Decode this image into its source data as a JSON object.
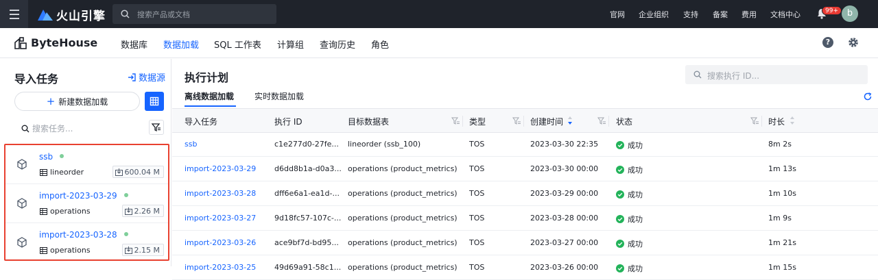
{
  "topbar": {
    "brand": "火山引擎",
    "search_placeholder": "搜索产品或文档",
    "nav": [
      "官网",
      "企业组织",
      "支持",
      "备案",
      "费用",
      "文档中心"
    ],
    "notification_count": "99+",
    "avatar_letter": "b"
  },
  "subnav": {
    "product": "ByteHouse",
    "items": [
      "数据库",
      "数据加载",
      "SQL 工作表",
      "计算组",
      "查询历史",
      "角色"
    ],
    "active_index": 1
  },
  "sidebar": {
    "title": "导入任务",
    "datasource_label": "数据源",
    "new_button": "新建数据加载",
    "search_placeholder": "搜索任务...",
    "tasks": [
      {
        "name": "ssb",
        "table": "lineorder",
        "size": "600.04 M"
      },
      {
        "name": "import-2023-03-29",
        "table": "operations",
        "size": "2.26 M"
      },
      {
        "name": "import-2023-03-28",
        "table": "operations",
        "size": "2.15 M"
      }
    ]
  },
  "main": {
    "title": "执行计划",
    "search_placeholder": "搜索执行 ID...",
    "tabs": [
      "离线数据加载",
      "实时数据加载"
    ],
    "columns": [
      "导入任务",
      "执行 ID",
      "目标数据表",
      "类型",
      "创建时间",
      "状态",
      "时长"
    ],
    "rows": [
      {
        "task": "ssb",
        "exec_id": "c1e277d0-27fe...",
        "target": "lineorder (ssb_100)",
        "type": "TOS",
        "created": "2023-03-30 22:35",
        "status": "成功",
        "duration": "8m 2s"
      },
      {
        "task": "import-2023-03-29",
        "exec_id": "d6dd8b1a-d0a3...",
        "target": "operations (product_metrics)",
        "type": "TOS",
        "created": "2023-03-30 00:00",
        "status": "成功",
        "duration": "1m 13s"
      },
      {
        "task": "import-2023-03-28",
        "exec_id": "dff6e6a1-ea1d-...",
        "target": "operations (product_metrics)",
        "type": "TOS",
        "created": "2023-03-29 00:00",
        "status": "成功",
        "duration": "1m 10s"
      },
      {
        "task": "import-2023-03-27",
        "exec_id": "9d18fc57-107c-...",
        "target": "operations (product_metrics)",
        "type": "TOS",
        "created": "2023-03-28 00:00",
        "status": "成功",
        "duration": "1m 9s"
      },
      {
        "task": "import-2023-03-26",
        "exec_id": "ace9bf7d-bd95...",
        "target": "operations (product_metrics)",
        "type": "TOS",
        "created": "2023-03-27 00:00",
        "status": "成功",
        "duration": "1m 21s"
      },
      {
        "task": "import-2023-03-25",
        "exec_id": "49d69a91-58c1...",
        "target": "operations (product_metrics)",
        "type": "TOS",
        "created": "2023-03-26 00:00",
        "status": "成功",
        "duration": "1m 15s"
      }
    ]
  },
  "colors": {
    "accent": "#1664ff",
    "topbar": "#1f232b",
    "success": "#23b35a",
    "highlight_border": "#e8402f"
  }
}
